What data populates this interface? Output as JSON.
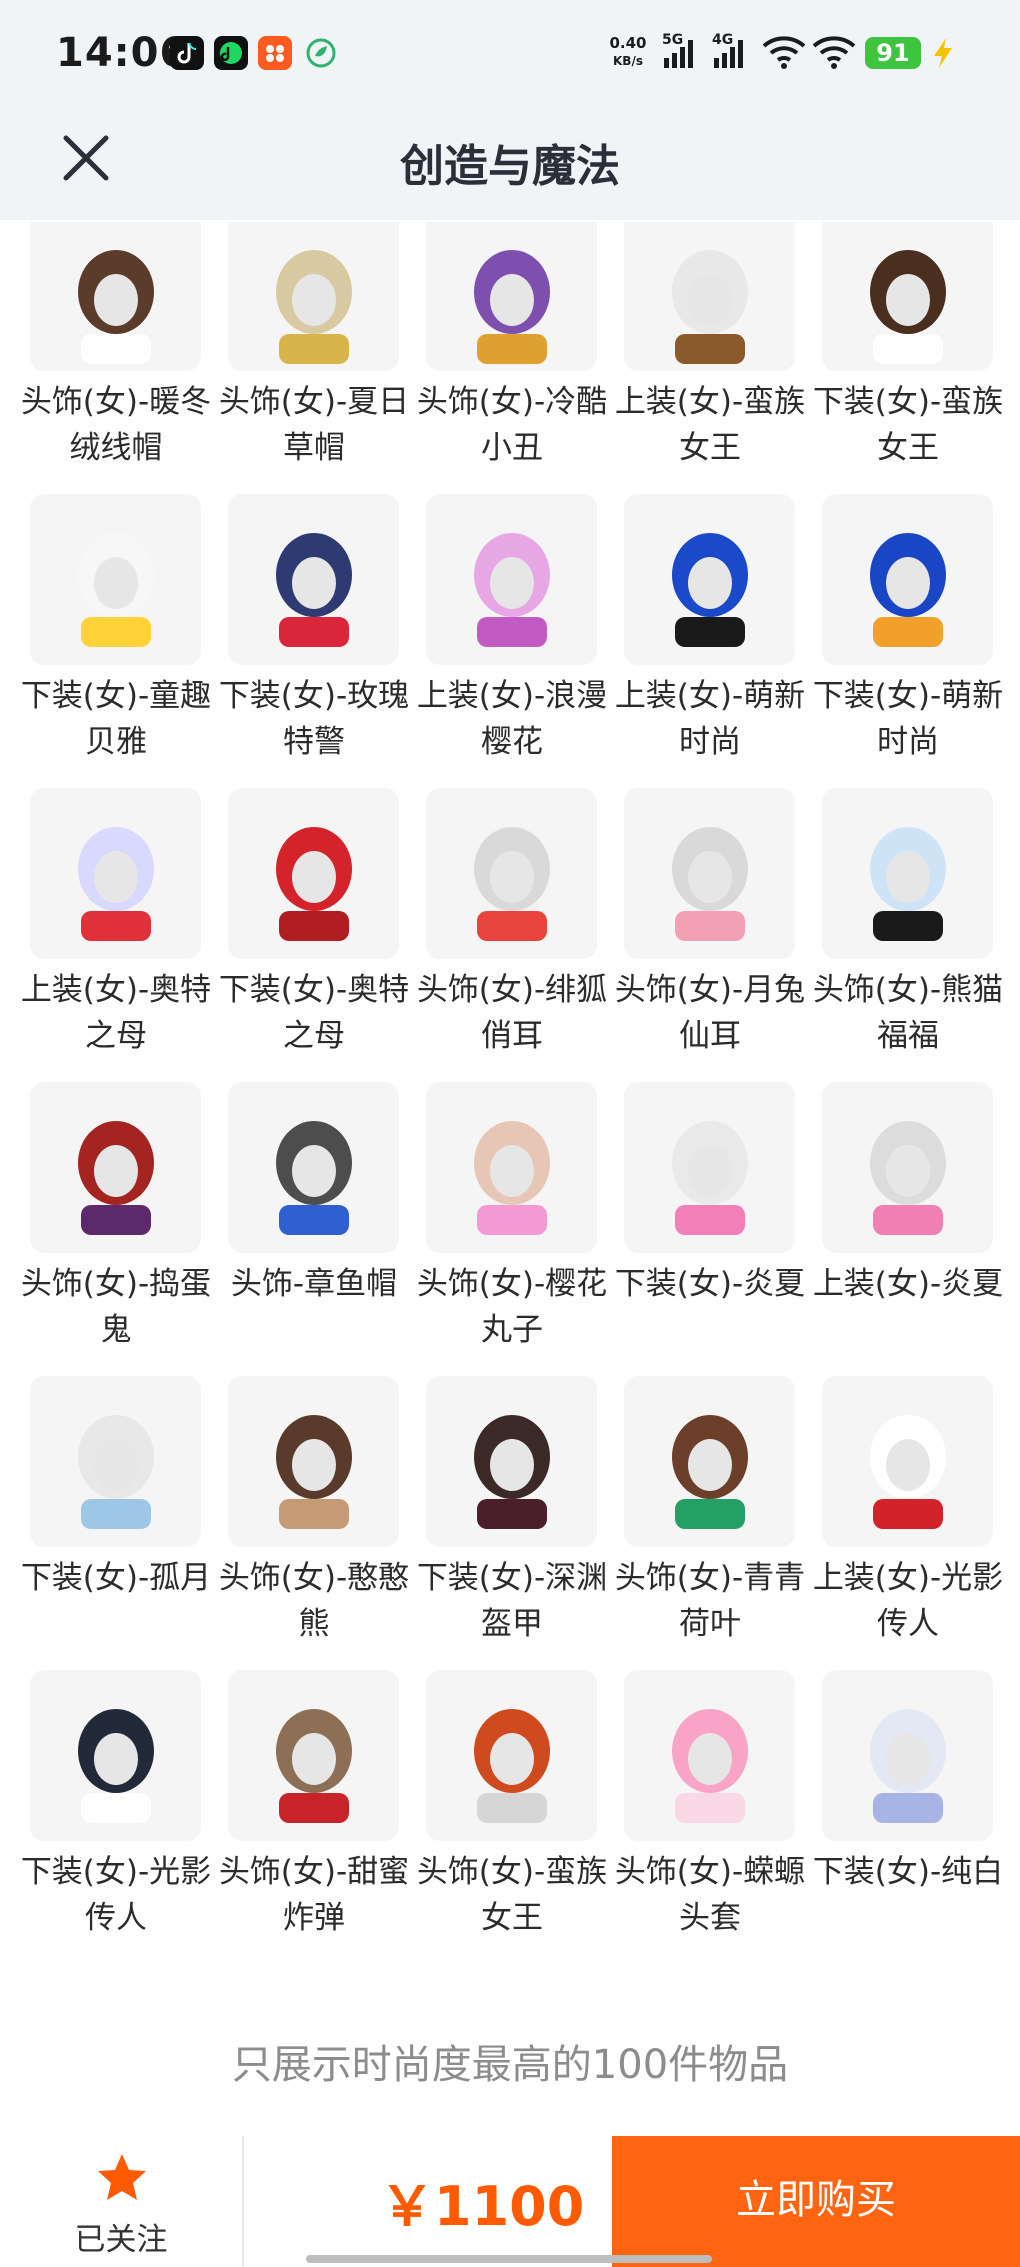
{
  "status_bar": {
    "time": "14:06",
    "net_speed_value": "0.40",
    "net_speed_unit": "KB/s",
    "sim1_label": "5G",
    "sim2_label": "4G",
    "battery": "91"
  },
  "header": {
    "title": "创造与魔法",
    "close_icon": "close-icon"
  },
  "items": [
    {
      "name": "头饰(女)-暖冬绒线帽"
    },
    {
      "name": "头饰(女)-夏日草帽"
    },
    {
      "name": "头饰(女)-冷酷小丑"
    },
    {
      "name": "上装(女)-蛮族女王"
    },
    {
      "name": "下装(女)-蛮族女王"
    },
    {
      "name": "下装(女)-童趣贝雅"
    },
    {
      "name": "下装(女)-玫瑰特警"
    },
    {
      "name": "上装(女)-浪漫樱花"
    },
    {
      "name": "上装(女)-萌新时尚"
    },
    {
      "name": "下装(女)-萌新时尚"
    },
    {
      "name": "上装(女)-奥特之母"
    },
    {
      "name": "下装(女)-奥特之母"
    },
    {
      "name": "头饰(女)-绯狐俏耳"
    },
    {
      "name": "头饰(女)-月兔仙耳"
    },
    {
      "name": "头饰(女)-熊猫福福"
    },
    {
      "name": "头饰(女)-捣蛋鬼"
    },
    {
      "name": "头饰-章鱼帽"
    },
    {
      "name": "头饰(女)-樱花丸子"
    },
    {
      "name": "下装(女)-炎夏"
    },
    {
      "name": "上装(女)-炎夏"
    },
    {
      "name": "下装(女)-孤月"
    },
    {
      "name": "头饰(女)-憨憨熊"
    },
    {
      "name": "下装(女)-深渊盔甲"
    },
    {
      "name": "头饰(女)-青青荷叶"
    },
    {
      "name": "上装(女)-光影传人"
    },
    {
      "name": "下装(女)-光影传人"
    },
    {
      "name": "头饰(女)-甜蜜炸弹"
    },
    {
      "name": "头饰(女)-蛮族女王"
    },
    {
      "name": "头饰(女)-蝾螈头套"
    },
    {
      "name": "下装(女)-纯白"
    }
  ],
  "notice": "只展示时尚度最高的100件物品",
  "bottom_bar": {
    "follow_label": "已关注",
    "price": "￥1100",
    "buy_label": "立即购买"
  },
  "colors": {
    "accent": "#ff6411",
    "price": "#ff5a00",
    "header_bg": "#f1f4f7",
    "thumb_bg": "#f5f5f5"
  }
}
